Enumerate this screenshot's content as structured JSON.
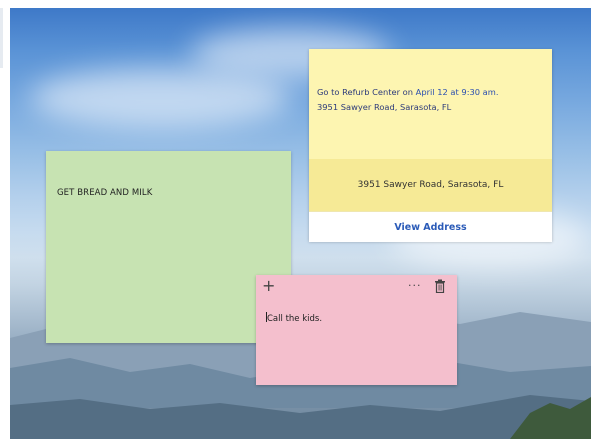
{
  "notes": {
    "green": {
      "text": "GET BREAD AND MILK",
      "color": "#c7e3b2"
    },
    "yellow": {
      "line1_prefix": "Go to Refurb Center on ",
      "line1_link": "April 12 at 9:30 am.",
      "line2": "3951 Sawyer Road, Sarasota, FL",
      "address_card": {
        "address": "3951 Sawyer Road, Sarasota, FL",
        "button_label": "View Address"
      },
      "color": "#fdf5b1"
    },
    "pink": {
      "toolbar": {
        "add_icon": "plus-icon",
        "menu_icon": "more-icon",
        "delete_icon": "trash-icon",
        "add_glyph": "+",
        "menu_glyph": "···"
      },
      "text": "Call the kids.",
      "color": "#f4bfcd"
    }
  }
}
